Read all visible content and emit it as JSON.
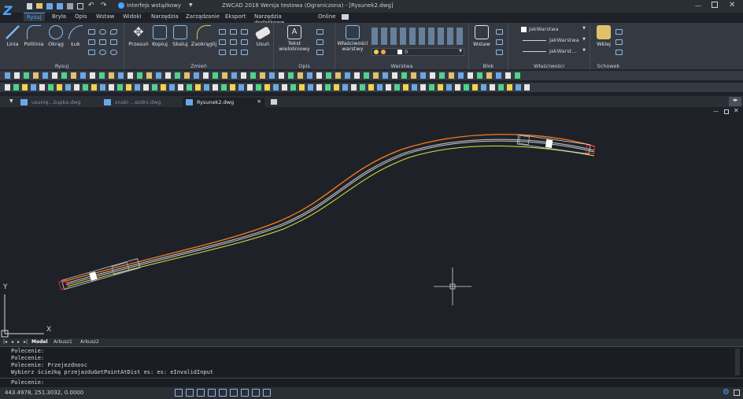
{
  "titlebar": {
    "workspace": "Interfejs wstążkowy",
    "title": "ZWCAD 2018 Wersja testowa (Ograniczona) - [Rysunek2.dwg]"
  },
  "ribbon_tabs": [
    "Rysuj",
    "Bryła",
    "Opis",
    "Wstaw",
    "Widoki",
    "Narzędzia",
    "Zarządzanie",
    "Eksport",
    "Narzędzia dodatkowe",
    "Online"
  ],
  "ribbon_groups": {
    "rysuj": {
      "label": "Rysuj",
      "buttons": [
        "Linia",
        "Polilinia",
        "Okrąg",
        "Łuk"
      ]
    },
    "zmien": {
      "label": "Zmień",
      "buttons": [
        "Przesuń",
        "Kopiuj",
        "Skaluj",
        "Zaokrąglij",
        "Usuń"
      ]
    },
    "opis": {
      "label": "Opis",
      "buttons": [
        "Tekst wieloliniowy"
      ]
    },
    "warstwa": {
      "label": "Warstwa",
      "buttons": [
        "Właściwości warstwy"
      ],
      "layer_value": "0"
    },
    "blok": {
      "label": "Blok",
      "buttons": [
        "Wstaw"
      ]
    },
    "wlasciwosci": {
      "label": "Właściwości",
      "color": "JakWarstwa",
      "linetype": "JakWarstwa",
      "lineweight": "JakWarst..."
    },
    "schowek": {
      "label": "Schowek",
      "buttons": [
        "Wklej"
      ]
    }
  },
  "doc_tabs": [
    "usunię...żupka.dwg",
    "znaki ...ezdni.dwg",
    "Rysunek2.dwg"
  ],
  "active_doc_tab": "Rysunek2.dwg",
  "axis": {
    "x": "X",
    "y": "Y"
  },
  "layout_tabs": [
    "Model",
    "Arkusz1",
    "Arkusz2"
  ],
  "command_history": [
    "Polecenie:",
    "Polecenie:",
    "Polecenie: Przejezdnosc",
    "Wybierz ścieżkę przejazduGetPointAtDist es:  es: eInvalidInput"
  ],
  "command_prompt": "Polecenie:",
  "coordinates": "443.4978, 251.3032, 0.0000",
  "colors": {
    "accent": "#4aa3ff",
    "path_left": "#e0e040",
    "path_right": "#ff7a1a",
    "path_center": "#ffffff"
  }
}
